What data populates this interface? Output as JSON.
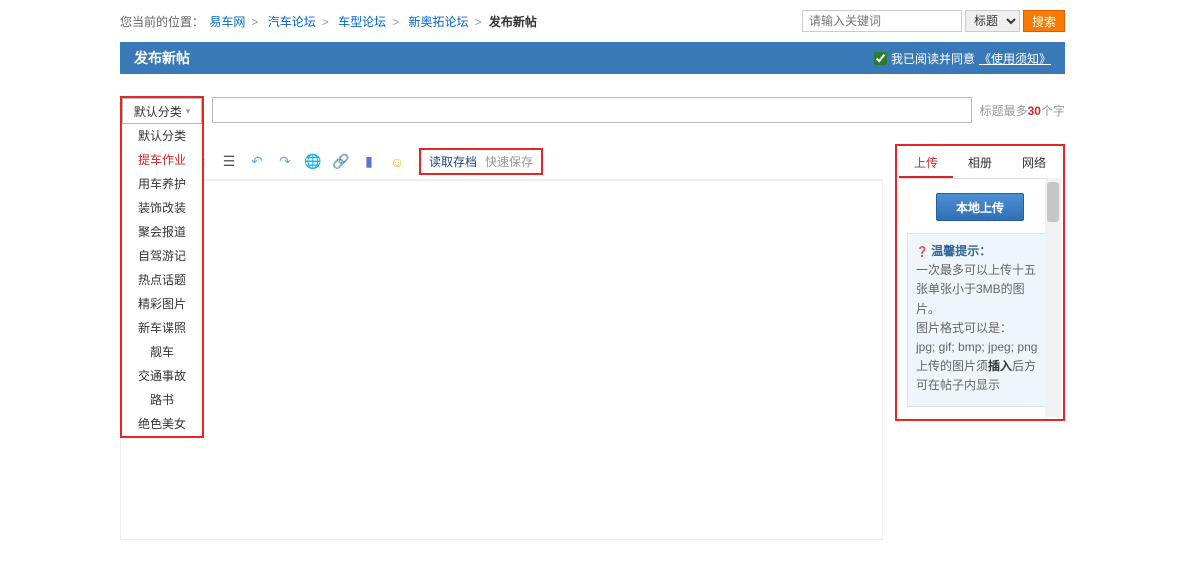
{
  "breadcrumb": {
    "label": "您当前的位置：",
    "items": [
      "易车网",
      "汽车论坛",
      "车型论坛",
      "新奥拓论坛"
    ],
    "current": "发布新帖"
  },
  "search": {
    "placeholder": "请输入关键词",
    "select": "标题",
    "button": "搜索"
  },
  "header": {
    "title": "发布新帖",
    "agree_text": "我已阅读并同意",
    "agree_link": "《使用须知》"
  },
  "category": {
    "selected": "默认分类",
    "options": [
      "默认分类",
      "提车作业",
      "用车养护",
      "装饰改装",
      "聚会报道",
      "自驾游记",
      "热点话题",
      "精彩图片",
      "新车谍照",
      "靓车",
      "交通事故",
      "路书",
      "绝色美女"
    ],
    "active_index": 1
  },
  "title_field": {
    "hint_prefix": "标题最多",
    "hint_num": "30",
    "hint_suffix": "个字"
  },
  "editor_buttons": {
    "load_archive": "读取存档",
    "quick_save": "快速保存"
  },
  "image_panel": {
    "tabs": [
      "上传",
      "相册",
      "网络"
    ],
    "active": 0,
    "local_upload": "本地上传",
    "tip_title": "温馨提示：",
    "tip_line1": "一次最多可以上传十五张单张小于3MB的图片。",
    "tip_line2": "图片格式可以是：",
    "tip_formats": "jpg; gif; bmp; jpeg; png",
    "tip_line3a": "上传的图片须",
    "tip_insert": "插入",
    "tip_line3b": "后方可在帖子内显示"
  }
}
